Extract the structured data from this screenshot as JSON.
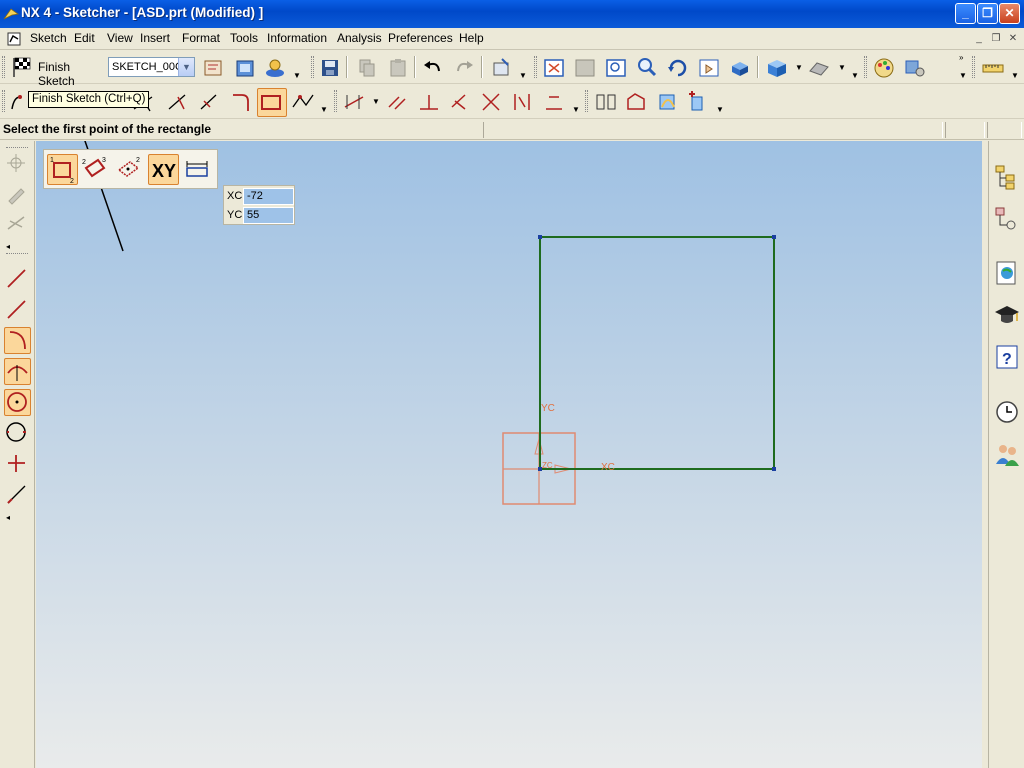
{
  "window": {
    "title": "NX 4 - Sketcher - [ASD.prt (Modified) ]",
    "minimize_label": "_",
    "maximize_label": "❐",
    "close_label": "✕"
  },
  "menubar": {
    "items": [
      "Sketch",
      "Edit",
      "View",
      "Insert",
      "Format",
      "Tools",
      "Information",
      "Analysis",
      "Preferences",
      "Help"
    ],
    "mdi_minimize": "_",
    "mdi_restore": "❐",
    "mdi_close": "✕"
  },
  "toolbar": {
    "finish_sketch_label": "Finish Sketch",
    "sketch_name": "SKETCH_00C",
    "tooltip": "Finish Sketch (Ctrl+Q)"
  },
  "cue": {
    "prompt": "Select the first point of the rectangle"
  },
  "rectangle_options": {
    "xy_label": "XY"
  },
  "coordinates": {
    "xc_label": "XC",
    "xc_value": "-72",
    "yc_label": "YC",
    "yc_value": "55"
  },
  "datum": {
    "yc_label": "YC",
    "xc_label": "XC",
    "zc_label": "ZC"
  },
  "colors": {
    "sketch_curve": "#1e6b1e",
    "datum": "#e07040",
    "active_tool": "#fbd79b",
    "titlebar": "#0a5fe6"
  }
}
